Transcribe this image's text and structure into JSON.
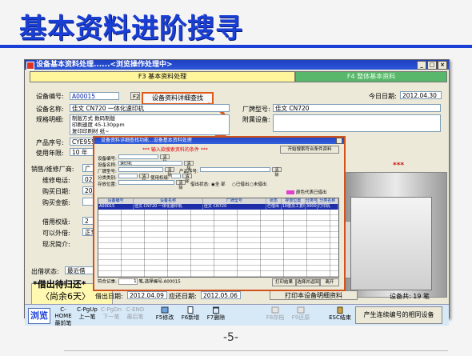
{
  "slide": {
    "title": "基本资料进阶搜寻",
    "page_number": "-5-"
  },
  "window": {
    "title": "设备基本资料处理......<浏览操作处理中>",
    "controls": [
      "_",
      "□",
      "×"
    ],
    "tabs": {
      "active": "F3 基本资料处理",
      "inactive": "F4 整体基本资料"
    }
  },
  "form": {
    "equipment_no_label": "设备编号:",
    "equipment_no": "A00015",
    "f2_label": "F2",
    "detail_search_button": "设备资料详细查找",
    "today_label": "今日日期:",
    "today": "2012.04.30",
    "name_label": "设备名称:",
    "name": "佳文 CN720 一体化速印机",
    "model_label": "厂牌型号:",
    "model": "佳文 CN720",
    "spec_label": "规格明细:",
    "spec_lines": [
      "制版方式 数码制版",
      "印刷速度 45-130ppm",
      "复印印刷材 纸~"
    ],
    "accessory_label": "附属设备:",
    "serial_label": "产品序号:",
    "serial": "CYE955",
    "years_label": "使用年限:",
    "years": "10 年",
    "vendor_label": "销售/维修厂商:",
    "vendor": "广",
    "phone_label": "维修电话:",
    "phone": "020",
    "purchase_date_label": "购买日期:",
    "purchase_date": "2012",
    "amount_label": "购买金额:",
    "borrow_level_label": "借用权级:",
    "borrow_level": "2",
    "lendable_label": "可以外借:",
    "lendable": "正常",
    "current_desc_label": "现况简介:",
    "lend_status_label": "出借状态:",
    "lend_status": "最近借",
    "borrowed_note": "*借出待归还*",
    "remaining_days": "〈尚余6天〉",
    "lend_date_label": "借出日期:",
    "lend_date": "2012.04.09",
    "return_due_label": "应还日期:",
    "return_due": "2012.05.06",
    "print_button": "打印本设备明细资料",
    "total_label": "设备共: 19 笔",
    "stars": "***"
  },
  "toolbar": {
    "browse": "浏览",
    "buttons": [
      {
        "key": "C-HOME",
        "label": "最前笔",
        "enabled": true
      },
      {
        "key": "C-PgUp",
        "label": "上一笔",
        "enabled": true
      },
      {
        "key": "C-PgDn",
        "label": "下一笔",
        "enabled": false
      },
      {
        "key": "C-END",
        "label": "最后笔",
        "enabled": false
      },
      {
        "key": "F5",
        "label": "F5修改",
        "enabled": true
      },
      {
        "key": "F6",
        "label": "F6新增",
        "enabled": true
      },
      {
        "key": "F7",
        "label": "F7删除",
        "enabled": true
      },
      {
        "key": "F8",
        "label": "F8存档",
        "enabled": false
      },
      {
        "key": "F9",
        "label": "F9还原",
        "enabled": false
      },
      {
        "key": "ESC",
        "label": "ESC结束",
        "enabled": true
      }
    ],
    "same_equipment_button": "产生连续编号的相同设备"
  },
  "dialog": {
    "title": "设备资料详细查找功能...设备基本资料处理",
    "hint": "*** 输入欲搜索资料的条件 ***",
    "start_button": "开始搜索符合条件资料",
    "fields": [
      {
        "label": "设备编号:",
        "value": ""
      },
      {
        "label": "设备名称:",
        "value": "速印机"
      },
      {
        "label": "厂牌型号:",
        "value": ""
      },
      {
        "label": "产品序号:",
        "value": ""
      },
      {
        "label": "分类类别:",
        "value": ""
      },
      {
        "label": "使用权级:",
        "value": ""
      },
      {
        "label": "存放位置:",
        "value": ""
      }
    ],
    "clear_label": "清除",
    "lend_state_label": "借出状态:",
    "lend_state_options": [
      "全",
      "部",
      "已借出",
      "未借出"
    ],
    "legend": "颜色代表已借出",
    "columns": [
      "设备编号",
      "设备名称",
      "厂牌型号",
      "状态",
      "存放位置",
      "分类号",
      "分类名称"
    ],
    "row": [
      "A00015",
      "佳文 CN720 一体化速印机",
      "佳文 CN720",
      "已借出",
      "10楼员工复印室",
      "30002",
      "打印机"
    ],
    "status_prefix": "符合记录:",
    "status_count": "1",
    "status_selected": "笔,选择编号:A00015",
    "bottom_buttons": [
      "打印结果",
      "选择并返回",
      "离开"
    ]
  }
}
